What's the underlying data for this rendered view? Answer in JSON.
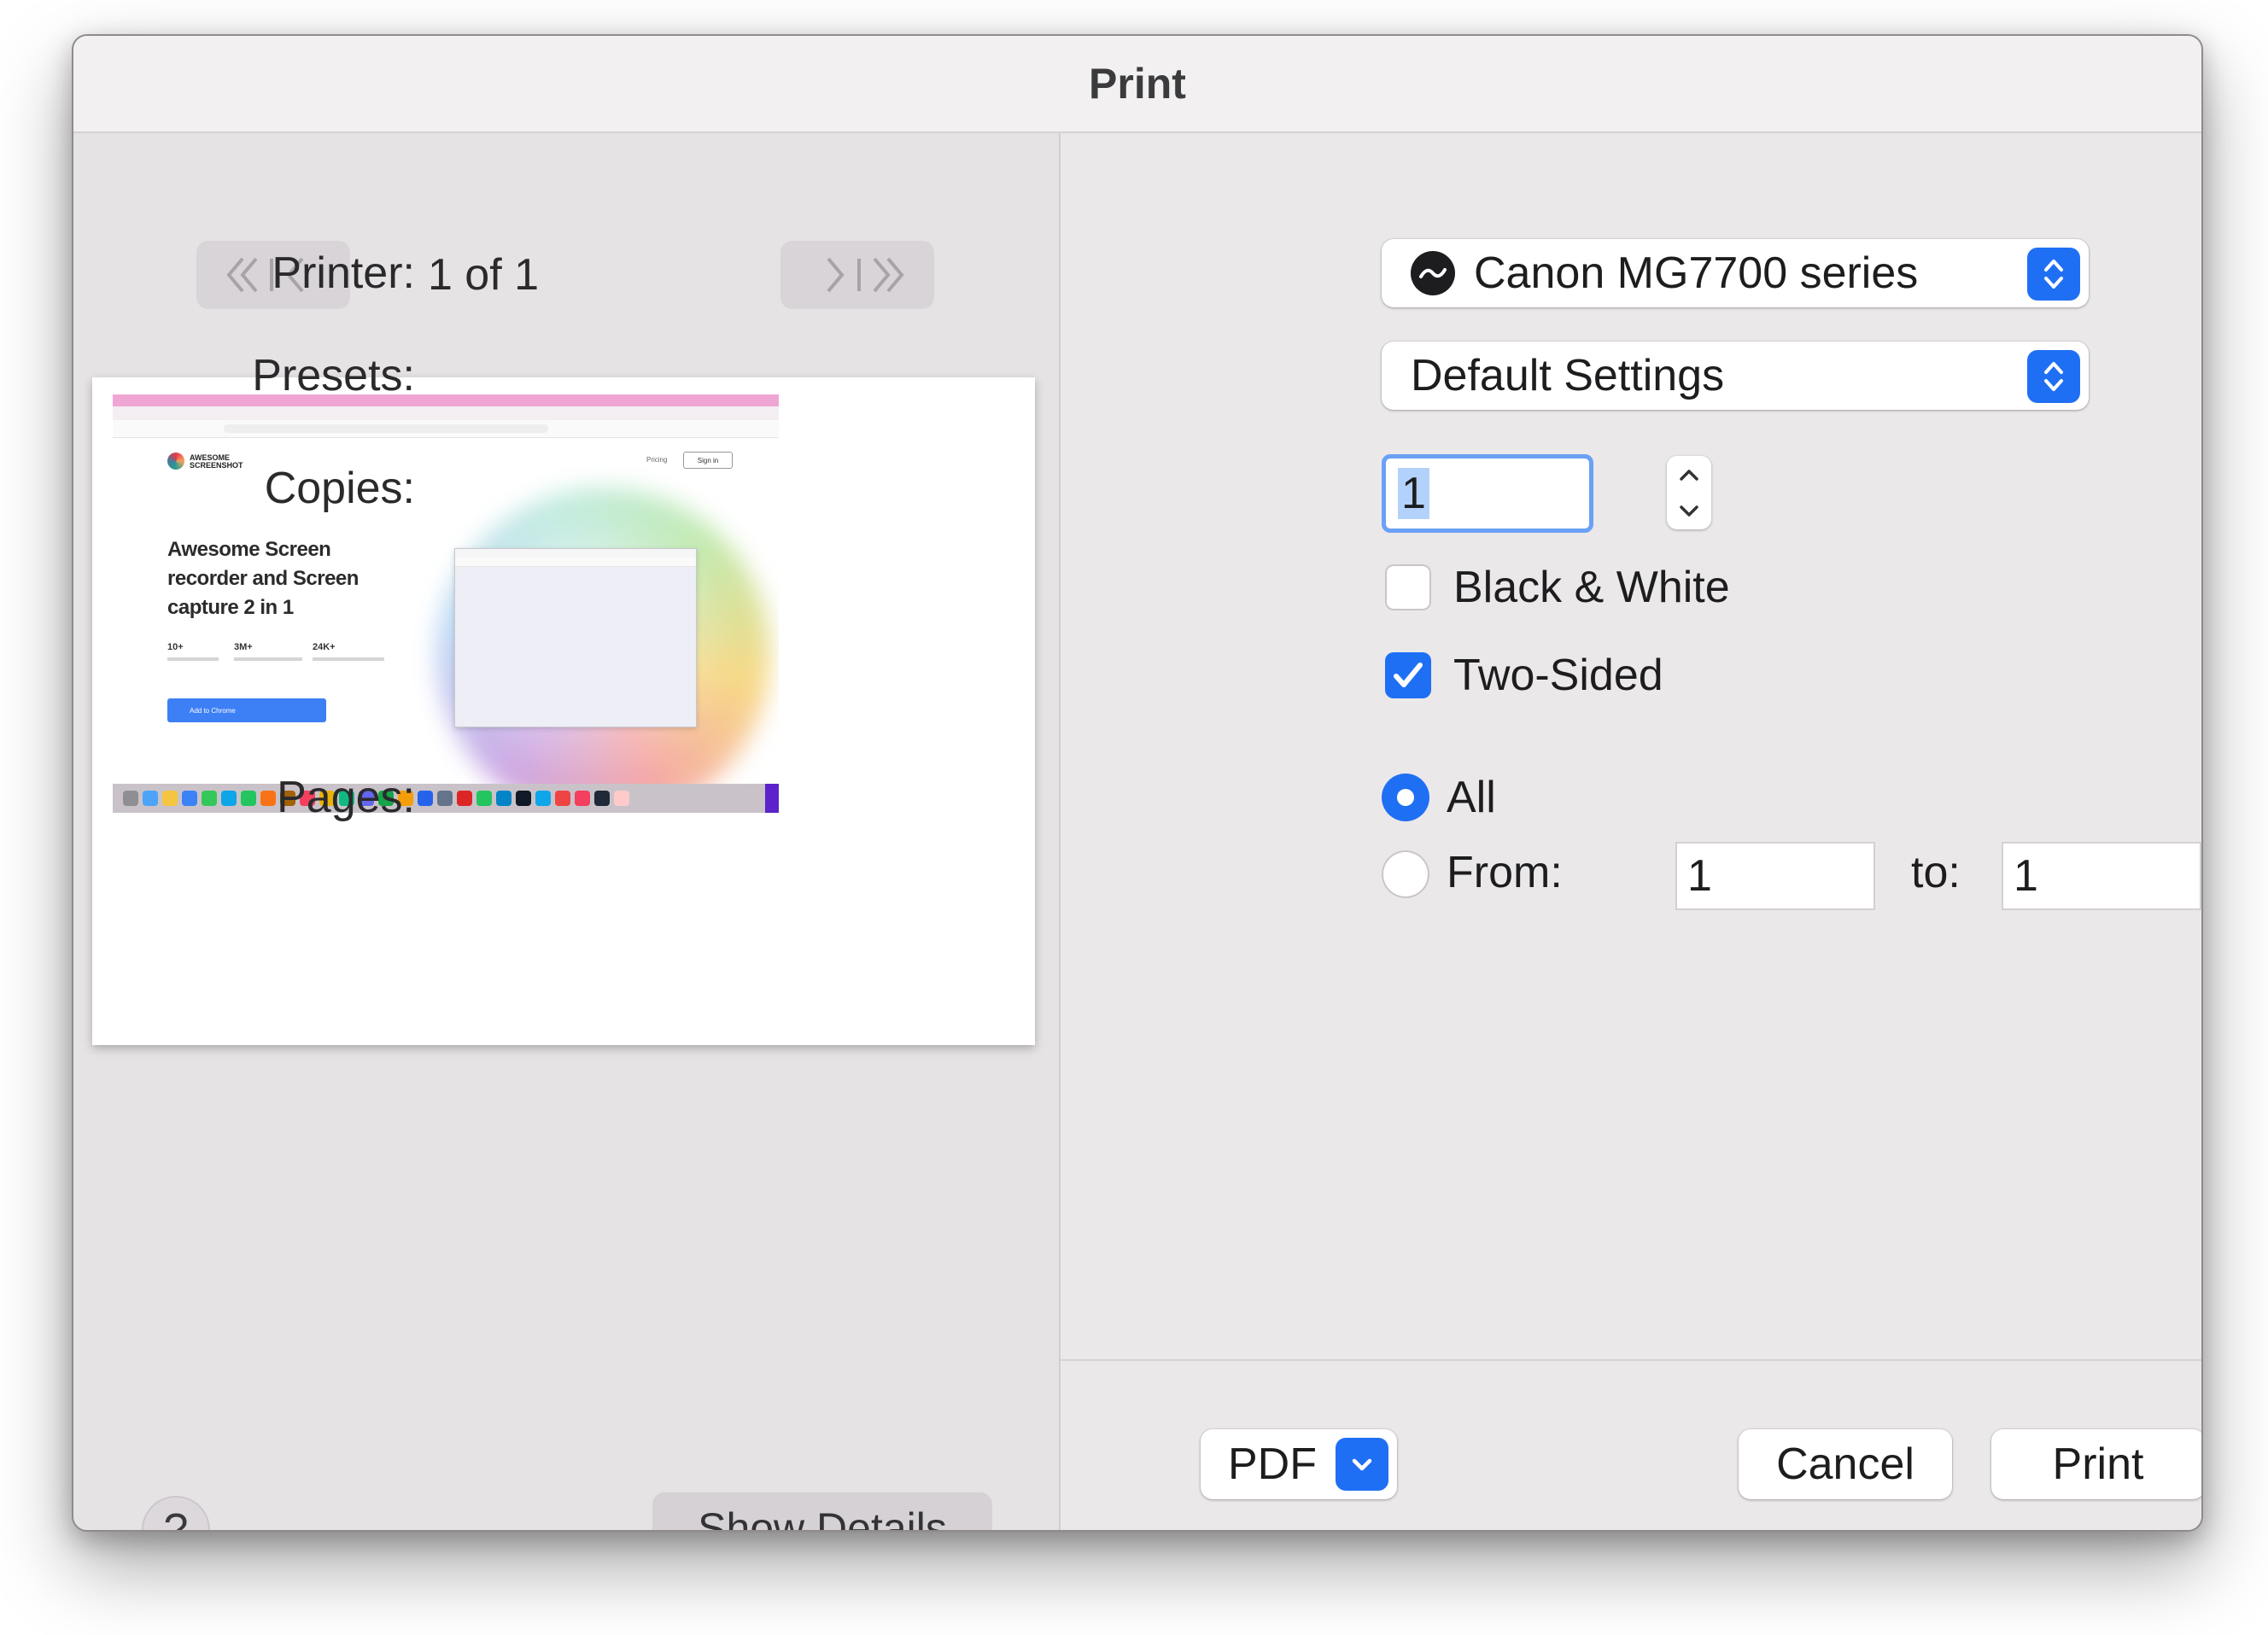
{
  "window": {
    "title": "Print"
  },
  "preview": {
    "page_indicator": "1 of 1",
    "nav_icons": [
      "first-page-icon",
      "previous-page-icon",
      "next-page-icon",
      "last-page-icon"
    ],
    "thumbnail": {
      "headline": "Awesome Screen recorder and Screen capture 2 in 1",
      "stats": [
        "10+",
        "3M+",
        "24K+"
      ],
      "logo_text": "AWESOME SCREENSHOT",
      "nav": {
        "pricing": "Pricing",
        "signin": "Sign in"
      },
      "cta": "Add to Chrome"
    },
    "help_label": "?",
    "show_details_label": "Show Details"
  },
  "form": {
    "printer": {
      "label": "Printer:",
      "value": "Canon MG7700 series"
    },
    "presets": {
      "label": "Presets:",
      "value": "Default Settings"
    },
    "copies": {
      "label": "Copies:",
      "value": "1"
    },
    "black_white": {
      "label": "Black & White",
      "checked": false
    },
    "two_sided": {
      "label": "Two-Sided",
      "checked": true
    },
    "pages": {
      "label": "Pages:",
      "all_label": "All",
      "all_selected": true,
      "from_label": "From:",
      "from_value": "1",
      "to_label": "to:",
      "to_value": "1"
    }
  },
  "footer": {
    "pdf_label": "PDF",
    "cancel_label": "Cancel",
    "print_label": "Print"
  },
  "colors": {
    "accent": "#1f6ff4",
    "focus_ring": "#6aa1f5",
    "window_bg": "#ebe8ea"
  }
}
